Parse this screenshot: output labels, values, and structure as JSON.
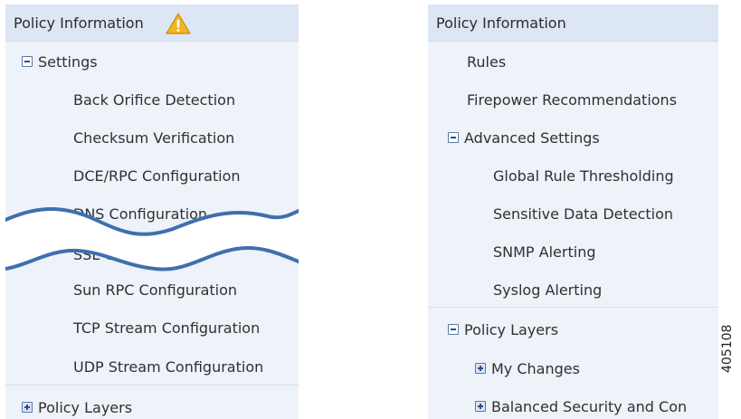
{
  "left_panel": {
    "title": "Policy Information",
    "settings_label": "Settings",
    "settings_items": [
      "Back Orifice Detection",
      "Checksum Verification",
      "DCE/RPC Configuration",
      "DNS Configuration",
      "SSL Configuration",
      "Sun RPC Configuration",
      "TCP Stream Configuration",
      "UDP Stream Configuration"
    ],
    "policy_layers_label": "Policy Layers"
  },
  "right_panel": {
    "title": "Policy Information",
    "items": [
      "Rules",
      "Firepower Recommendations"
    ],
    "advanced_label": "Advanced Settings",
    "advanced_items": [
      "Global Rule Thresholding",
      "Sensitive Data Detection",
      "SNMP Alerting",
      "Syslog Alerting"
    ],
    "policy_layers_label": "Policy Layers",
    "layer_items": [
      "My Changes",
      "Balanced Security and Con"
    ]
  },
  "figure_id": "405108",
  "colors": {
    "panel_bg": "#eef2f9",
    "header_bg": "#dde6f5",
    "break_line": "#3f6fae",
    "warning": "#f2b51e"
  },
  "icons": [
    "warning-icon",
    "collapse-icon",
    "expand-icon",
    "break-wave"
  ]
}
